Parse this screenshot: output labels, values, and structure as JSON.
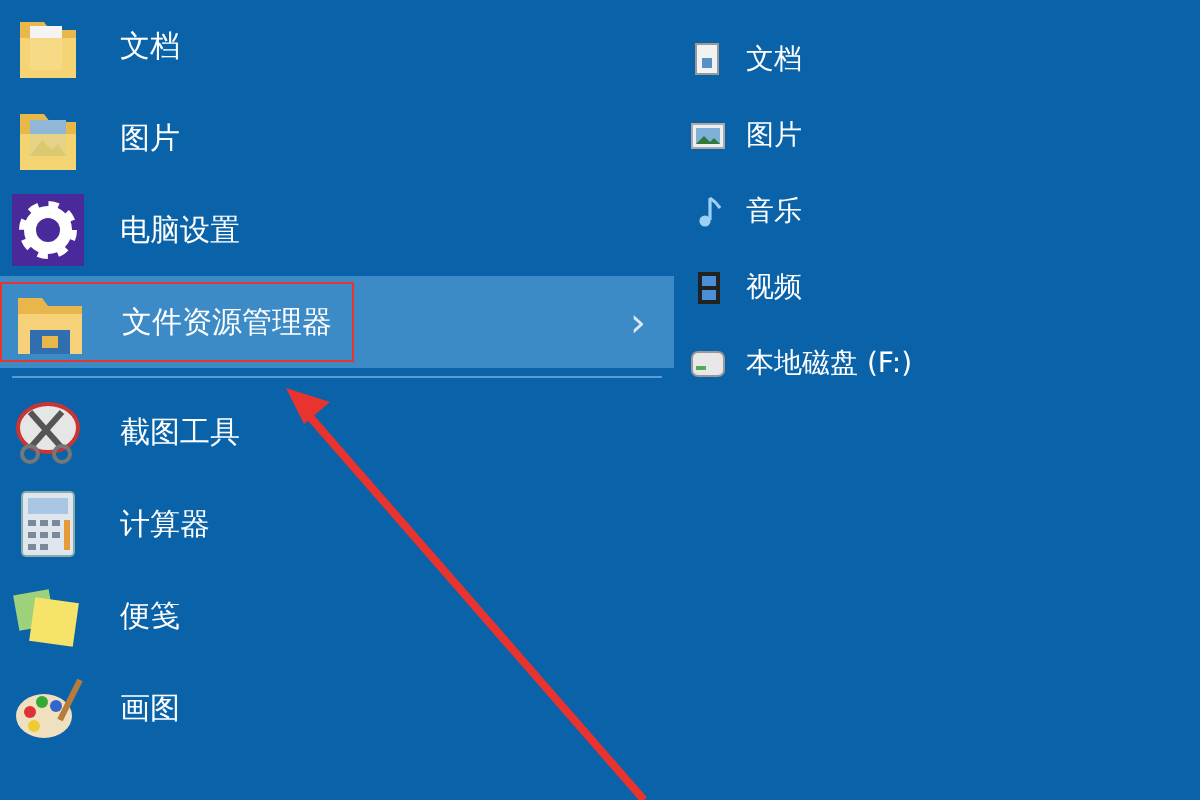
{
  "app_groups": [
    {
      "items": [
        {
          "label": "文档",
          "kind": "documents-folder",
          "selected": false,
          "annotated": false
        },
        {
          "label": "图片",
          "kind": "pictures-folder",
          "selected": false,
          "annotated": false
        },
        {
          "label": "电脑设置",
          "kind": "gear",
          "selected": false,
          "annotated": false
        },
        {
          "label": "文件资源管理器",
          "kind": "explorer-folder",
          "selected": true,
          "annotated": true,
          "submenu_arrow": "›"
        }
      ]
    },
    {
      "items": [
        {
          "label": "截图工具",
          "kind": "scissors",
          "selected": false,
          "annotated": false
        },
        {
          "label": "计算器",
          "kind": "calculator",
          "selected": false,
          "annotated": false
        },
        {
          "label": "便笺",
          "kind": "sticky-notes",
          "selected": false,
          "annotated": false
        },
        {
          "label": "画图",
          "kind": "palette",
          "selected": false,
          "annotated": false
        }
      ]
    }
  ],
  "jump_list": [
    {
      "label": "文档",
      "kind": "document"
    },
    {
      "label": "图片",
      "kind": "picture"
    },
    {
      "label": "音乐",
      "kind": "music"
    },
    {
      "label": "视频",
      "kind": "film"
    },
    {
      "label": "本地磁盘 (F:)",
      "kind": "drive"
    }
  ]
}
